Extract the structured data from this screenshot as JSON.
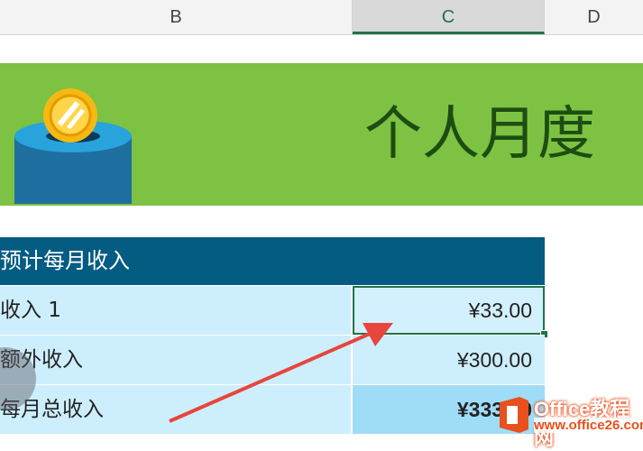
{
  "columns": {
    "b": "B",
    "c": "C",
    "d": "D"
  },
  "banner": {
    "title": "个人月度",
    "icon": "piggy-bank-coin-icon"
  },
  "table": {
    "header": "预计每月收入",
    "rows": [
      {
        "label": "收入 1",
        "value": "¥33.00"
      },
      {
        "label": "额外收入",
        "value": "¥300.00"
      },
      {
        "label": "每月总收入",
        "value": "¥333.00"
      }
    ]
  },
  "watermark": {
    "brand": "Office教程网",
    "url": "www.office26.com"
  },
  "colors": {
    "banner_green": "#7dc242",
    "header_blue": "#055c83",
    "row_light": "#cdeefd",
    "selection_green": "#217346",
    "arrow_red": "#e8453c"
  }
}
